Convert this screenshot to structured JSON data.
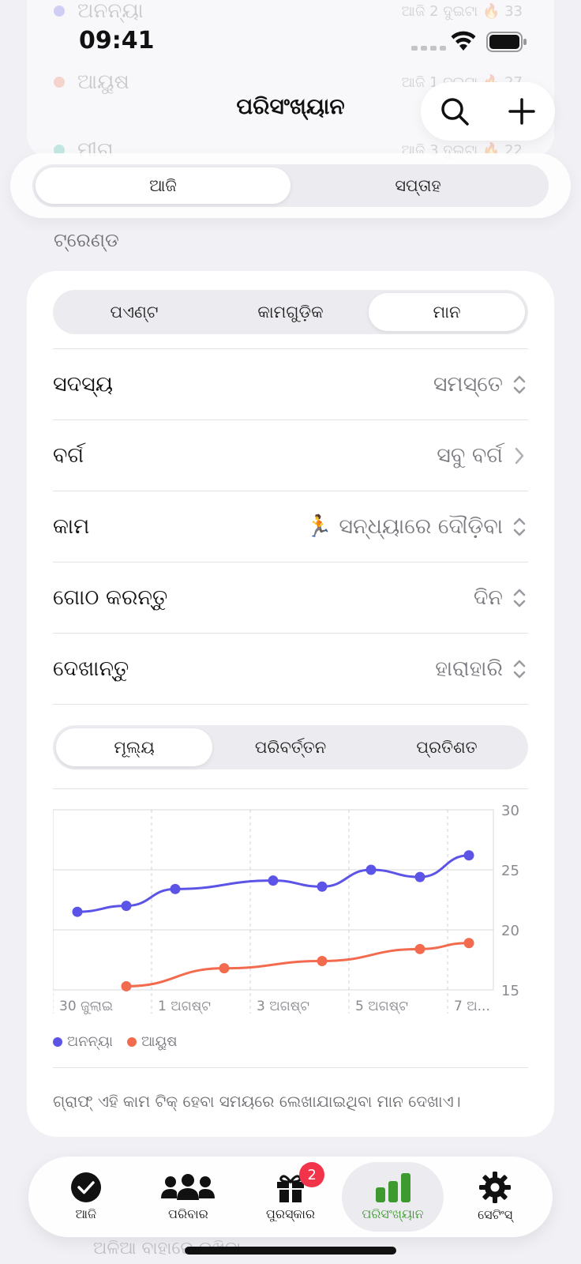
{
  "status": {
    "time": "09:41"
  },
  "background_list": [
    {
      "name": "ଅନନ୍ୟା",
      "meta": "ଆଜି 2 ଦୁଇଟା  🔥 33",
      "color": "#5b54e6"
    },
    {
      "name": "ଆୟୁଷ",
      "meta": "ଆଜି 1 ଦୁଇଟା  🔥 27",
      "color": "#f26b4e"
    },
    {
      "name": "ମୀରା",
      "meta": "ଆଜି 3 ଦୁଇଟା  🔥 22",
      "color": "#2bb5a0"
    }
  ],
  "header": {
    "title": "ପରିସଂଖ୍ୟାନ",
    "search_icon": "search-icon",
    "add_icon": "plus-icon"
  },
  "range": {
    "options": [
      "ଆଜି",
      "ସପ୍ତାହ"
    ],
    "selected": 0
  },
  "section": {
    "label": "ଟ୍ରେଣ୍ଡ"
  },
  "metric_tabs": {
    "options": [
      "ପଏଣ୍ଟ",
      "କାମଗୁଡ଼ିକ",
      "ମାନ"
    ],
    "selected": 2
  },
  "rows": [
    {
      "label": "ସଦସ୍ୟ",
      "value": "ସମସ୍ତେ",
      "indicator": "updown"
    },
    {
      "label": "ବର୍ଗ",
      "value": "ସବୁ ବର୍ଗ",
      "indicator": "right"
    },
    {
      "label": "କାମ",
      "value": "🏃 ସନ୍ଧ୍ୟାରେ ଦୌଡ଼ିବା",
      "indicator": "updown"
    },
    {
      "label": "ଗୋଠ କରନ୍ତୁ",
      "value": "ଦିନ",
      "indicator": "updown"
    },
    {
      "label": "ଦେଖାନ୍ତୁ",
      "value": "ହାରାହାରି",
      "indicator": "updown"
    }
  ],
  "chart_mode": {
    "options": [
      "ମୂଲ୍ୟ",
      "ପରିବର୍ତ୍ତନ",
      "ପ୍ରତିଶତ"
    ],
    "selected": 0
  },
  "chart_data": {
    "type": "line",
    "x": [
      "30 ଜୁଲାଇ",
      "31 ଜୁଲାଇ",
      "1 ଅଗଷ୍ଟ",
      "2 ଅଗଷ୍ଟ",
      "3 ଅଗଷ୍ଟ",
      "4 ଅଗଷ୍ଟ",
      "5 ଅଗଷ୍ଟ",
      "6 ଅଗଷ୍ଟ",
      "7 ଅଗଷ୍ଟ"
    ],
    "x_tick_labels": [
      "30 ଜୁଲାଇ",
      "1 ଅଗଷ୍ଟ",
      "3 ଅଗଷ୍ଟ",
      "5 ଅଗଷ୍ଟ",
      "7 ଅ..."
    ],
    "series": [
      {
        "name": "ଅନନ୍ୟା",
        "color": "#5b54e6",
        "values": [
          21.5,
          22.0,
          23.4,
          null,
          24.1,
          23.6,
          25.0,
          24.4,
          26.2
        ]
      },
      {
        "name": "ଆୟୁଷ",
        "color": "#f26b4e",
        "values": [
          null,
          15.3,
          null,
          16.8,
          null,
          17.4,
          null,
          18.4,
          18.9
        ]
      }
    ],
    "ylim": [
      15,
      30
    ],
    "y_ticks": [
      15,
      20,
      25,
      30
    ],
    "grid": true,
    "legend": "bottom-left"
  },
  "footnote": "ଗ୍ରାଫ୍ ଏହି କାମ ଟିକ୍ ହେବା ସମୟରେ ଲେଖାଯାଇଥିବା ମାନ ଦେଖାଏ।",
  "tabbar": {
    "items": [
      {
        "label": "ଆଜି",
        "icon": "checkmark-circle-icon"
      },
      {
        "label": "ପରିବାର",
        "icon": "people-icon"
      },
      {
        "label": "ପୁରସ୍କାର",
        "icon": "gift-icon",
        "badge": "2"
      },
      {
        "label": "ପରିସଂଖ୍ୟାନ",
        "icon": "bar-chart-icon"
      },
      {
        "label": "ସେଟିଂସ୍",
        "icon": "gear-icon"
      }
    ],
    "selected": 3,
    "accent": "#3e9a2e"
  },
  "behind_text": "ଅଳିଆ ବାହାରେ ରଖିବା"
}
